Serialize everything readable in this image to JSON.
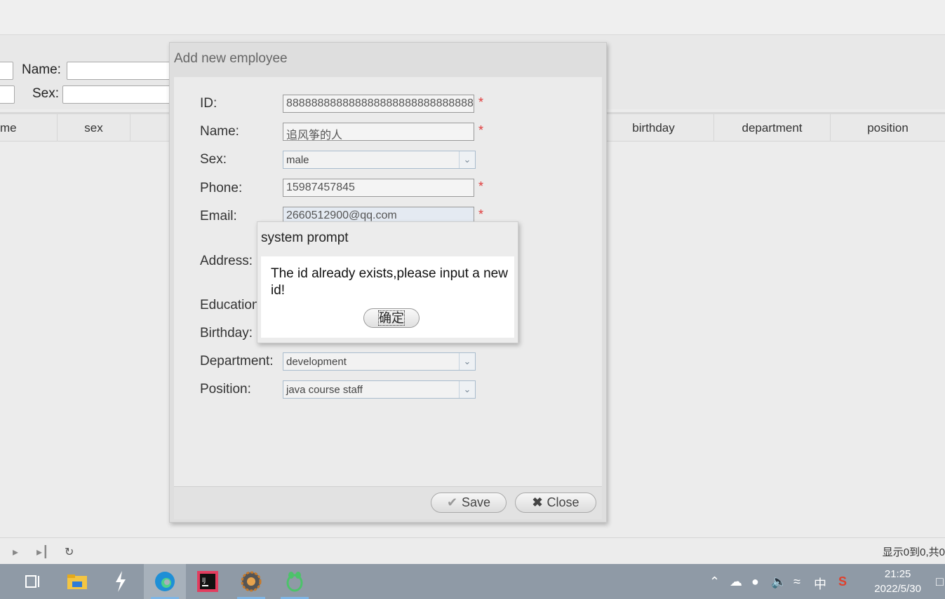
{
  "search": {
    "name_label": "Name:",
    "sex_label": "Sex:"
  },
  "grid": {
    "columns": [
      "me",
      "sex",
      "birthday",
      "department",
      "position"
    ]
  },
  "pager": {
    "info": "显示0到0,共0"
  },
  "dialog": {
    "title": "Add new employee",
    "fields": {
      "id_label": "ID:",
      "id_value": "88888888888888888888888888888888",
      "name_label": "Name:",
      "name_value": "追风筝的人",
      "sex_label": "Sex:",
      "sex_value": "male",
      "phone_label": "Phone:",
      "phone_value": "15987457845",
      "email_label": "Email:",
      "email_value": "2660512900@qq.com",
      "address_label": "Address:",
      "education_label": "Education",
      "birthday_label": "Birthday:",
      "department_label": "Department:",
      "department_value": "development",
      "position_label": "Position:",
      "position_value": "java course staff"
    },
    "required_mark": "*",
    "save_label": "Save",
    "close_label": "Close"
  },
  "prompt": {
    "title": "system prompt",
    "message": "The id already exists,please input a new id!",
    "ok_label": "确定"
  },
  "taskbar": {
    "apps": [
      "task-view",
      "file-explorer",
      "visual-studio-code",
      "edge",
      "intellij-idea",
      "hbuilder",
      "navicat"
    ],
    "tray": {
      "ime": "中",
      "time": "21:25",
      "date": "2022/5/30"
    }
  }
}
